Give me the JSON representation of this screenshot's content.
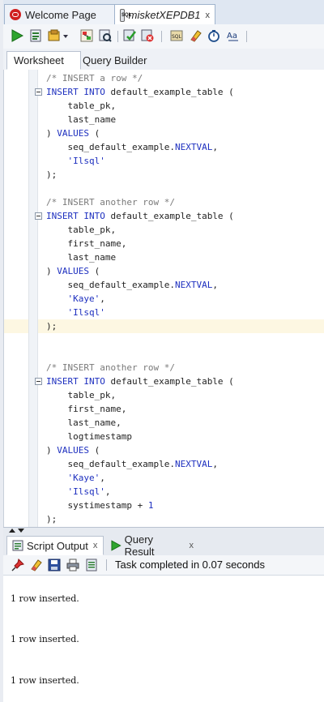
{
  "doc_tabs": [
    {
      "label": "Welcome Page",
      "icon": "oracle-icon"
    },
    {
      "label": "misketXEPDB1",
      "icon": "sql-worksheet-icon",
      "close": "x"
    }
  ],
  "toolbar": {
    "icons": [
      "run-statement-icon",
      "run-script-icon",
      "autotrace-icon",
      "explain-plan-icon",
      "sql-tuning-advisor-icon",
      "commit-icon",
      "rollback-icon",
      "sql-history-icon",
      "clear-icon",
      "sql-monitor-icon",
      "format-case-icon"
    ]
  },
  "worksheet_tabs": [
    "Worksheet",
    "Query Builder"
  ],
  "editor": {
    "lines": [
      [
        {
          "t": "/* INSERT a row */",
          "c": "comment"
        }
      ],
      [
        {
          "t": "INSERT INTO",
          "c": "kw"
        },
        {
          "t": " default_example_table (",
          "c": "plain"
        }
      ],
      [
        {
          "t": "    table_pk,",
          "c": "plain"
        }
      ],
      [
        {
          "t": "    last_name",
          "c": "plain"
        }
      ],
      [
        {
          "t": ") ",
          "c": "plain"
        },
        {
          "t": "VALUES",
          "c": "kw"
        },
        {
          "t": " (",
          "c": "plain"
        }
      ],
      [
        {
          "t": "    seq_default_example.",
          "c": "plain"
        },
        {
          "t": "NEXTVAL",
          "c": "kw"
        },
        {
          "t": ",",
          "c": "plain"
        }
      ],
      [
        {
          "t": "    'Ilsql'",
          "c": "str"
        }
      ],
      [
        {
          "t": ");",
          "c": "plain"
        }
      ],
      [],
      [
        {
          "t": "/* INSERT another row */",
          "c": "comment"
        }
      ],
      [
        {
          "t": "INSERT INTO",
          "c": "kw"
        },
        {
          "t": " default_example_table (",
          "c": "plain"
        }
      ],
      [
        {
          "t": "    table_pk,",
          "c": "plain"
        }
      ],
      [
        {
          "t": "    first_name,",
          "c": "plain"
        }
      ],
      [
        {
          "t": "    last_name",
          "c": "plain"
        }
      ],
      [
        {
          "t": ") ",
          "c": "plain"
        },
        {
          "t": "VALUES",
          "c": "kw"
        },
        {
          "t": " (",
          "c": "plain"
        }
      ],
      [
        {
          "t": "    seq_default_example.",
          "c": "plain"
        },
        {
          "t": "NEXTVAL",
          "c": "kw"
        },
        {
          "t": ",",
          "c": "plain"
        }
      ],
      [
        {
          "t": "    'Kaye'",
          "c": "str"
        },
        {
          "t": ",",
          "c": "plain"
        }
      ],
      [
        {
          "t": "    'Ilsql'",
          "c": "str"
        }
      ],
      [
        {
          "t": ");",
          "c": "plain"
        }
      ],
      [],
      [],
      [
        {
          "t": "/* INSERT another row */",
          "c": "comment"
        }
      ],
      [
        {
          "t": "INSERT INTO",
          "c": "kw"
        },
        {
          "t": " default_example_table (",
          "c": "plain"
        }
      ],
      [
        {
          "t": "    table_pk,",
          "c": "plain"
        }
      ],
      [
        {
          "t": "    first_name,",
          "c": "plain"
        }
      ],
      [
        {
          "t": "    last_name,",
          "c": "plain"
        }
      ],
      [
        {
          "t": "    logtimestamp",
          "c": "plain"
        }
      ],
      [
        {
          "t": ") ",
          "c": "plain"
        },
        {
          "t": "VALUES",
          "c": "kw"
        },
        {
          "t": " (",
          "c": "plain"
        }
      ],
      [
        {
          "t": "    seq_default_example.",
          "c": "plain"
        },
        {
          "t": "NEXTVAL",
          "c": "kw"
        },
        {
          "t": ",",
          "c": "plain"
        }
      ],
      [
        {
          "t": "    'Kaye'",
          "c": "str"
        },
        {
          "t": ",",
          "c": "plain"
        }
      ],
      [
        {
          "t": "    'Ilsql'",
          "c": "str"
        },
        {
          "t": ",",
          "c": "plain"
        }
      ],
      [
        {
          "t": "    systimestamp + ",
          "c": "plain"
        },
        {
          "t": "1",
          "c": "num"
        }
      ],
      [
        {
          "t": ");",
          "c": "plain"
        }
      ]
    ],
    "highlighted_line": 18,
    "fold_markers": [
      2,
      11,
      23
    ]
  },
  "output_tabs": [
    {
      "label": "Script Output",
      "icon": "script-output-icon",
      "close": "x"
    },
    {
      "label": "Query Result",
      "icon": "query-result-icon",
      "close": "x"
    }
  ],
  "output_toolbar": {
    "icons": [
      "pin-icon",
      "eraser-icon",
      "save-icon",
      "print-icon",
      "buffer-size-icon"
    ],
    "status": "Task completed in 0.07 seconds"
  },
  "output_lines": [
    "1 row inserted.",
    "1 row inserted.",
    "1 row inserted."
  ]
}
